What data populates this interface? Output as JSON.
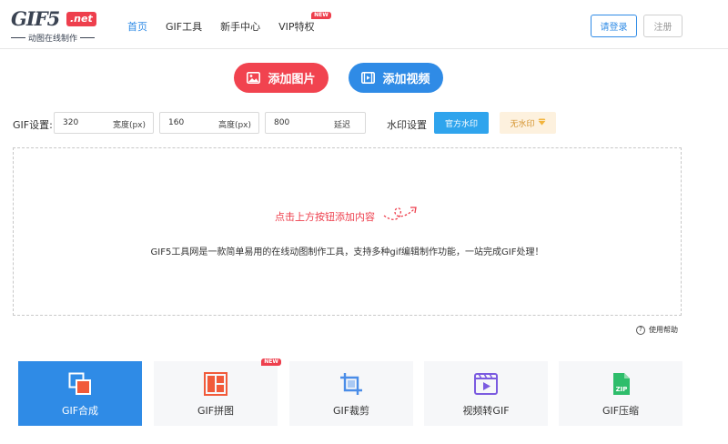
{
  "header": {
    "logo_main": "GIF5",
    "logo_badge": ".net",
    "logo_tagline": "动图在线制作",
    "nav": [
      {
        "label": "首页",
        "active": true
      },
      {
        "label": "GIF工具",
        "active": false
      },
      {
        "label": "新手中心",
        "active": false
      },
      {
        "label": "VIP特权",
        "active": false,
        "badge": "NEW"
      }
    ],
    "login_label": "请登录",
    "register_label": "注册"
  },
  "actions": {
    "add_image_label": "添加图片",
    "add_video_label": "添加视频"
  },
  "gif_settings": {
    "label": "GIF设置:",
    "width": {
      "value": "320",
      "unit": "宽度(px)"
    },
    "height": {
      "value": "160",
      "unit": "高度(px)"
    },
    "delay": {
      "value": "800",
      "unit": "延迟"
    }
  },
  "watermark": {
    "label": "水印设置",
    "official_label": "官方水印",
    "none_label": "无水印"
  },
  "dropzone": {
    "hint": "点击上方按钮添加内容",
    "description": "GIF5工具网是一款简单易用的在线动图制作工具，支持多种gif编辑制作功能，一站完成GIF处理！"
  },
  "help_label": "使用帮助",
  "tools": [
    {
      "label": "GIF合成",
      "icon": "gif-merge-icon",
      "active": true
    },
    {
      "label": "GIF拼图",
      "icon": "gif-collage-icon",
      "active": false,
      "badge": "NEW"
    },
    {
      "label": "GIF裁剪",
      "icon": "crop-icon",
      "active": false
    },
    {
      "label": "视频转GIF",
      "icon": "video-to-gif-icon",
      "active": false
    },
    {
      "label": "GIF压缩",
      "icon": "zip-icon",
      "active": false
    }
  ],
  "colors": {
    "brand_red": "#f1434f",
    "brand_blue": "#2f8be6",
    "watermark_blue": "#2fa4ed",
    "gold_bg": "#fdf1de"
  }
}
